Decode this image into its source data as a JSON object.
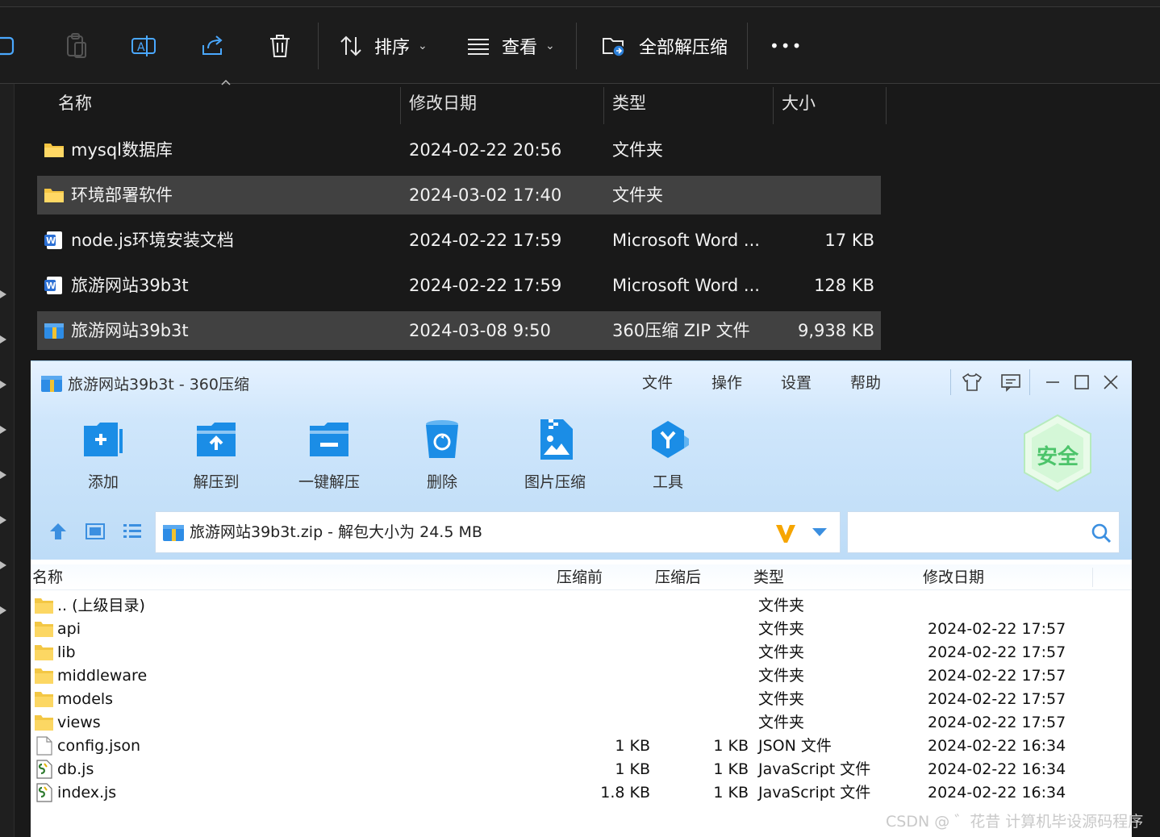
{
  "explorer": {
    "toolbar": {
      "sort_label": "排序",
      "view_label": "查看",
      "extract_all_label": "全部解压缩",
      "more_label": "•••"
    },
    "columns": {
      "name": "名称",
      "date": "修改日期",
      "type": "类型",
      "size": "大小"
    },
    "rows": [
      {
        "name": "mysql数据库",
        "date": "2024-02-22 20:56",
        "type": "文件夹",
        "size": "",
        "icon": "folder-icon"
      },
      {
        "name": "环境部署软件",
        "date": "2024-03-02 17:40",
        "type": "文件夹",
        "size": "",
        "icon": "folder-icon"
      },
      {
        "name": "node.js环境安装文档",
        "date": "2024-02-22 17:59",
        "type": "Microsoft Word ...",
        "size": "17 KB",
        "icon": "word-doc-icon"
      },
      {
        "name": "旅游网站39b3t",
        "date": "2024-02-22 17:59",
        "type": "Microsoft Word ...",
        "size": "128 KB",
        "icon": "word-doc-icon"
      },
      {
        "name": "旅游网站39b3t",
        "date": "2024-03-08 9:50",
        "type": "360压缩 ZIP 文件",
        "size": "9,938 KB",
        "icon": "zip-archive-icon"
      }
    ]
  },
  "zipwin": {
    "title": "旅游网站39b3t - 360压缩",
    "menu": [
      "文件",
      "操作",
      "设置",
      "帮助"
    ],
    "tools": [
      {
        "label": "添加",
        "icon": "add-folder-icon"
      },
      {
        "label": "解压到",
        "icon": "extract-to-icon"
      },
      {
        "label": "一键解压",
        "icon": "one-click-extract-icon"
      },
      {
        "label": "删除",
        "icon": "delete-bin-icon"
      },
      {
        "label": "图片压缩",
        "icon": "image-compress-icon"
      },
      {
        "label": "工具",
        "icon": "tools-icon"
      }
    ],
    "safe_label": "安全",
    "path_text": "旅游网站39b3t.zip - 解包大小为 24.5 MB",
    "search_placeholder": "",
    "columns": {
      "name": "名称",
      "before": "压缩前",
      "after": "压缩后",
      "type": "类型",
      "date": "修改日期"
    },
    "rows": [
      {
        "name": ".. (上级目录)",
        "before": "",
        "after": "",
        "type": "文件夹",
        "date": "",
        "icon": "folder-icon"
      },
      {
        "name": "api",
        "before": "",
        "after": "",
        "type": "文件夹",
        "date": "2024-02-22 17:57",
        "icon": "folder-icon"
      },
      {
        "name": "lib",
        "before": "",
        "after": "",
        "type": "文件夹",
        "date": "2024-02-22 17:57",
        "icon": "folder-icon"
      },
      {
        "name": "middleware",
        "before": "",
        "after": "",
        "type": "文件夹",
        "date": "2024-02-22 17:57",
        "icon": "folder-icon"
      },
      {
        "name": "models",
        "before": "",
        "after": "",
        "type": "文件夹",
        "date": "2024-02-22 17:57",
        "icon": "folder-icon"
      },
      {
        "name": "views",
        "before": "",
        "after": "",
        "type": "文件夹",
        "date": "2024-02-22 17:57",
        "icon": "folder-icon"
      },
      {
        "name": "config.json",
        "before": "1 KB",
        "after": "1 KB",
        "type": "JSON 文件",
        "date": "2024-02-22 16:34",
        "icon": "blank-file-icon"
      },
      {
        "name": "db.js",
        "before": "1 KB",
        "after": "1 KB",
        "type": "JavaScript 文件",
        "date": "2024-02-22 16:34",
        "icon": "script-file-icon"
      },
      {
        "name": "index.js",
        "before": "1.8 KB",
        "after": "1 KB",
        "type": "JavaScript 文件",
        "date": "2024-02-22 16:34",
        "icon": "script-file-icon"
      }
    ]
  },
  "watermark": "CSDN @ ゛花昔  计算机毕设源码程序",
  "colors": {
    "explorer_bg": "#191919",
    "selected_row": "#414141",
    "zip_accent": "#1e90e6",
    "safe_green": "#4cc46a"
  }
}
